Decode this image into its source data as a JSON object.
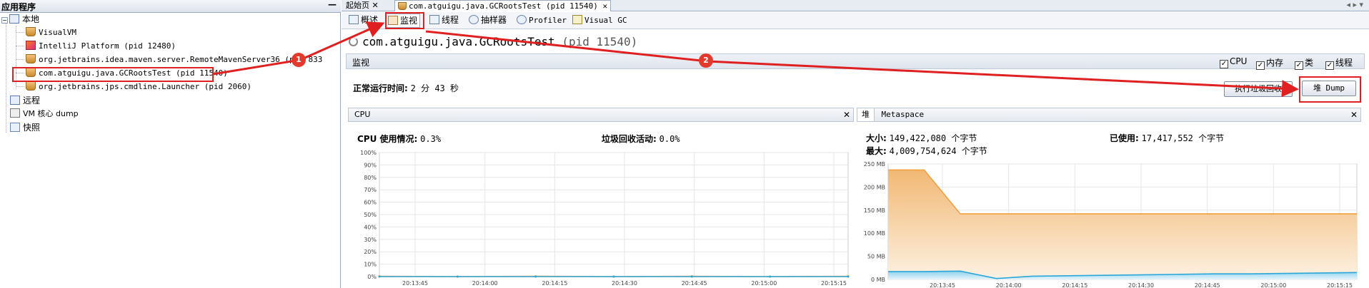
{
  "left_panel": {
    "title": "应用程序",
    "minimize": "—",
    "tree": {
      "local_label": "本地",
      "local_items": [
        {
          "label": "VisualVM",
          "icon": "visualvm-icon"
        },
        {
          "label": "IntelliJ Platform (pid 12480)",
          "icon": "intellij-icon"
        },
        {
          "label": "org.jetbrains.idea.maven.server.RemoteMavenServer36 (pid 833",
          "icon": "java-cup-icon"
        },
        {
          "label": "com.atguigu.java.GCRootsTest (pid 11540)",
          "icon": "java-cup-icon"
        },
        {
          "label": "org.jetbrains.jps.cmdline.Launcher (pid 2060)",
          "icon": "java-cup-icon"
        }
      ],
      "remote_label": "远程",
      "vm_dump_label": "VM 核心 dump",
      "snapshot_label": "快照"
    }
  },
  "tabs": [
    {
      "label": "起始页",
      "closable": "✕"
    },
    {
      "label": "com.atguigu.java.GCRootsTest (pid 11540)",
      "closable": "✕"
    }
  ],
  "subtabs": [
    {
      "label": "概述"
    },
    {
      "label": "监视"
    },
    {
      "label": "线程"
    },
    {
      "label": "抽样器"
    },
    {
      "label": "Profiler"
    },
    {
      "label": "Visual GC"
    }
  ],
  "page_title": "com.atguigu.java.GCRootsTest",
  "page_title_pid": "(pid 11540)",
  "monitor": {
    "label": "监视",
    "checkboxes": [
      {
        "label": "CPU",
        "checked": "✓"
      },
      {
        "label": "内存",
        "checked": "✓"
      },
      {
        "label": "类",
        "checked": "✓"
      },
      {
        "label": "线程",
        "checked": "✓"
      }
    ]
  },
  "uptime": {
    "label": "正常运行时间:",
    "value": "2 分 43 秒"
  },
  "buttons": {
    "gc": "执行垃圾回收",
    "heap_dump": "堆 Dump"
  },
  "cpu_panel": {
    "tab": "CPU",
    "close": "✕",
    "usage_label": "CPU 使用情况:",
    "usage_value": "0.3%",
    "gc_label": "垃圾回收活动:",
    "gc_value": "0.0%"
  },
  "heap_panel": {
    "tab_heap": "堆",
    "tab_meta": "Metaspace",
    "close": "✕",
    "size_label": "大小:",
    "size_value": "149,422,080 个字节",
    "max_label": "最大:",
    "max_value": "4,009,754,624 个字节",
    "used_label": "已使用:",
    "used_value": "17,417,552 个字节"
  },
  "annotations": {
    "badge1": "1",
    "badge2": "2"
  },
  "colors": {
    "heap_size": "#f0a040",
    "heap_used": "#2aa6d9",
    "cpu": "#f0a040",
    "annotation": "#e02020"
  },
  "chart_data": [
    {
      "type": "line",
      "name": "cpu",
      "x": [
        "20:13:45",
        "20:14:00",
        "20:14:15",
        "20:14:30",
        "20:14:45",
        "20:15:00",
        "20:15:15"
      ],
      "ylim": [
        0,
        100
      ],
      "ytick_labels": [
        "0%",
        "10%",
        "20%",
        "30%",
        "40%",
        "50%",
        "60%",
        "70%",
        "80%",
        "90%",
        "100%"
      ],
      "series": [
        {
          "values": [
            0.3,
            0.0,
            0.3,
            0.0,
            0.3,
            0.0,
            0.3
          ]
        },
        {
          "values": [
            0,
            0,
            0,
            0,
            0,
            0,
            0
          ]
        }
      ],
      "grid": true
    },
    {
      "type": "area",
      "name": "heap",
      "x": [
        "20:13:45",
        "20:14:00",
        "20:14:15",
        "20:14:30",
        "20:14:45",
        "20:15:00",
        "20:15:15"
      ],
      "ylim": [
        0,
        250
      ],
      "ytick_labels": [
        "0 MB",
        "50 MB",
        "100 MB",
        "150 MB",
        "200 MB",
        "250 MB"
      ],
      "series": [
        {
          "values": [
            237,
            237,
            142,
            142,
            142,
            142,
            142,
            142,
            142,
            142,
            142,
            142,
            142,
            142
          ]
        },
        {
          "values": [
            17,
            17,
            18,
            2,
            7,
            8,
            9,
            10,
            11,
            12,
            12,
            13,
            14,
            15
          ]
        }
      ],
      "grid": true
    }
  ]
}
